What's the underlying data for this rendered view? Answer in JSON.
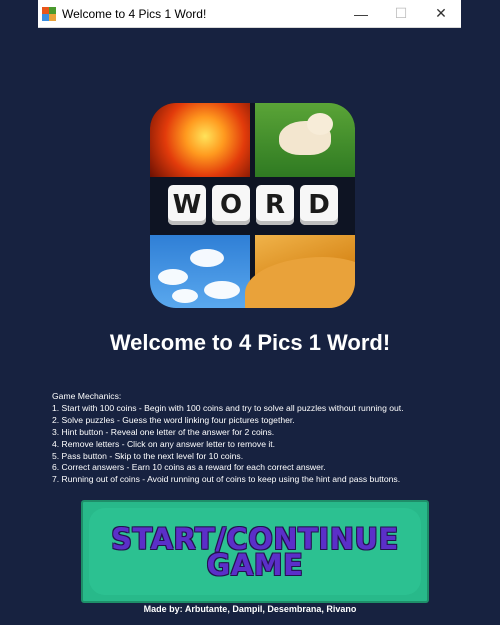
{
  "window": {
    "title": "Welcome to 4 Pics 1 Word!",
    "minimize_glyph": "—",
    "maximize_glyph": "☐",
    "close_glyph": "✕"
  },
  "logo": {
    "letters": [
      "W",
      "O",
      "R",
      "D"
    ]
  },
  "heading": "Welcome to 4 Pics 1 Word!",
  "mechanics": {
    "title": "Game Mechanics:",
    "items": [
      "1. Start with 100 coins - Begin with 100 coins and try to solve all puzzles without running out.",
      "2. Solve puzzles - Guess the word linking four pictures together.",
      "3. Hint button - Reveal one letter of the answer for 2 coins.",
      "4. Remove letters - Click on any answer letter to remove it.",
      "5. Pass button - Skip to the next level for 10 coins.",
      "6. Correct answers - Earn 10 coins as a reward for each correct answer.",
      "7. Running out of coins - Avoid running out of coins to keep using the hint and pass buttons."
    ]
  },
  "start_button": {
    "line1": "START/CONTINUE",
    "line2": "GAME"
  },
  "credits": "Made by: Arbutante, Dampil, Desembrana, Rivano",
  "colors": {
    "background": "#172240",
    "button": "#28b98a",
    "button_text": "#5b2fc9"
  }
}
